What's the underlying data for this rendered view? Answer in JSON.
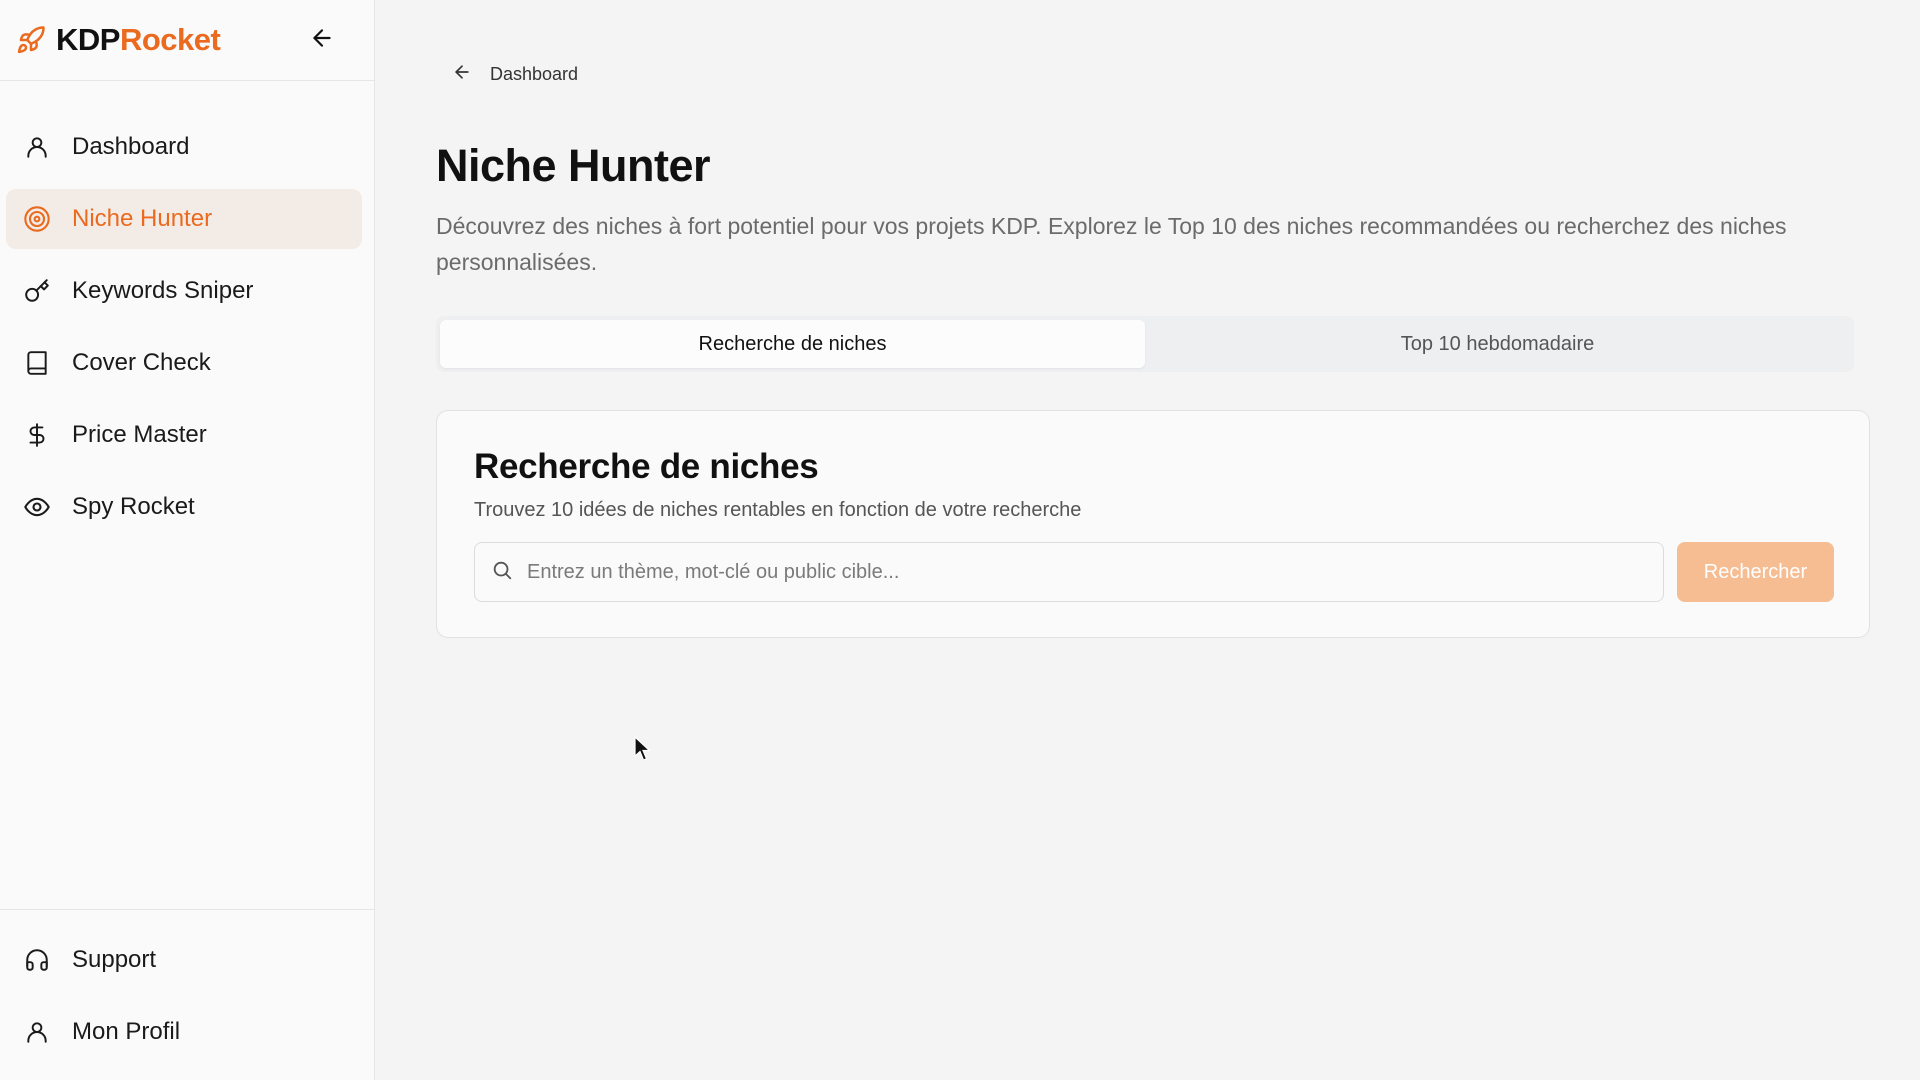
{
  "brand": {
    "part1": "KDP",
    "part2": "Rocket",
    "accent": "#ea6a1f"
  },
  "sidebar": {
    "items": [
      {
        "label": "Dashboard",
        "icon": "user-icon",
        "active": false
      },
      {
        "label": "Niche Hunter",
        "icon": "target-icon",
        "active": true
      },
      {
        "label": "Keywords Sniper",
        "icon": "key-icon",
        "active": false
      },
      {
        "label": "Cover Check",
        "icon": "book-icon",
        "active": false
      },
      {
        "label": "Price Master",
        "icon": "dollar-icon",
        "active": false
      },
      {
        "label": "Spy Rocket",
        "icon": "eye-icon",
        "active": false
      }
    ],
    "bottom": [
      {
        "label": "Support",
        "icon": "headphones-icon"
      },
      {
        "label": "Mon Profil",
        "icon": "user-icon"
      }
    ]
  },
  "breadcrumb": {
    "label": "Dashboard"
  },
  "page": {
    "title": "Niche Hunter",
    "description": "Découvrez des niches à fort potentiel pour vos projets KDP. Explorez le Top 10 des niches recommandées ou recherchez des niches personnalisées."
  },
  "tabs": [
    {
      "label": "Recherche de niches",
      "active": true
    },
    {
      "label": "Top 10 hebdomadaire",
      "active": false
    }
  ],
  "search_card": {
    "title": "Recherche de niches",
    "subtitle": "Trouvez 10 idées de niches rentables en fonction de votre recherche",
    "placeholder": "Entrez un thème, mot-clé ou public cible...",
    "value": "",
    "button_label": "Rechercher"
  }
}
